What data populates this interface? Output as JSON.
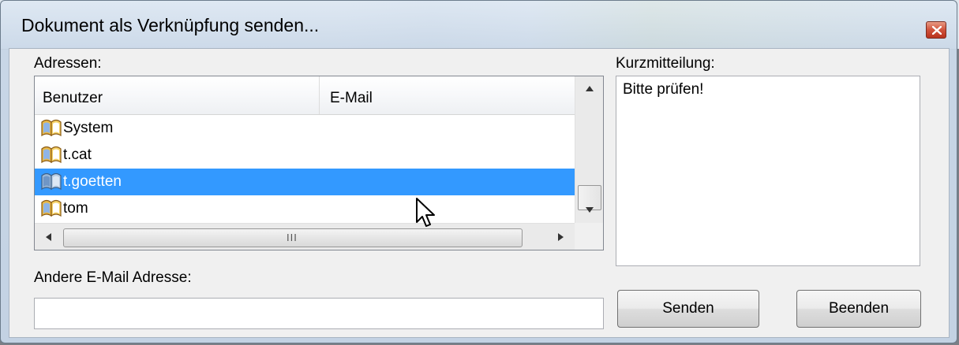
{
  "window": {
    "title": "Dokument als Verknüpfung senden..."
  },
  "addresses": {
    "label": "Adressen:",
    "columns": [
      "Benutzer",
      "E-Mail"
    ],
    "rows": [
      {
        "user": "System",
        "email": ""
      },
      {
        "user": "t.cat",
        "email": ""
      },
      {
        "user": "t.goetten",
        "email": "",
        "selected": true
      },
      {
        "user": "tom",
        "email": ""
      }
    ],
    "hscroll_grip": "III"
  },
  "other_email": {
    "label": "Andere E-Mail Adresse:",
    "value": ""
  },
  "message": {
    "label": "Kurzmitteilung:",
    "value": "Bitte prüfen!"
  },
  "buttons": {
    "send": "Senden",
    "quit": "Beenden"
  },
  "colors": {
    "selection": "#3399ff",
    "close": "#c8432d"
  },
  "icons": {
    "row": "address-book-icon",
    "close": "close-icon",
    "cursor": "mouse-pointer-icon"
  }
}
